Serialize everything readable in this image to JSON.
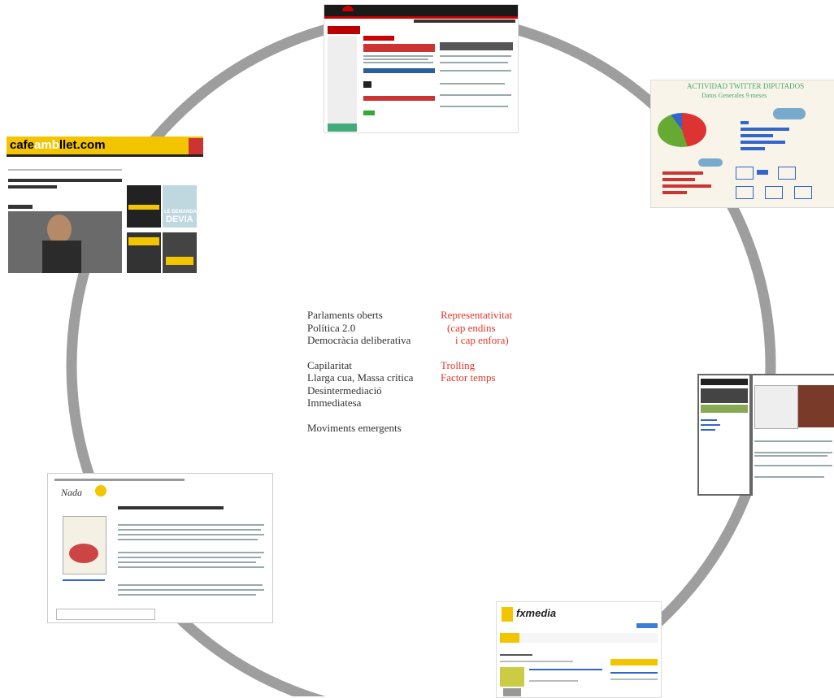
{
  "center": {
    "left_items": [
      "Parlaments oberts",
      "Política 2.0",
      "Democràcia deliberativa",
      "",
      "Capilaritat",
      "Llarga cua, Massa crítica",
      "Desintermediació",
      "Immediatesa",
      "",
      "Moviments emergents"
    ],
    "right_items": [
      "Representativitat",
      "(cap endins",
      "i cap enfora)",
      "",
      "Trolling",
      "Factor temps"
    ]
  },
  "thumbs": {
    "cafe": {
      "logo_a": "cafe",
      "logo_b": "amb",
      "logo_c": "llet.com",
      "badge_1": "LE DEMANDA",
      "badge_2": "DEVIA"
    },
    "twitter": {
      "title": "ACTIVIDAD TWITTER DIPUTADOS",
      "subtitle": "Datos Generales 9 meses"
    },
    "fxmedia": {
      "logo": "fxmedia"
    },
    "nada": {
      "logo": "Nada"
    }
  },
  "colors": {
    "ring": "#9e9e9e",
    "accent_red": "#e8352a",
    "cafe_yellow": "#f2c500"
  }
}
